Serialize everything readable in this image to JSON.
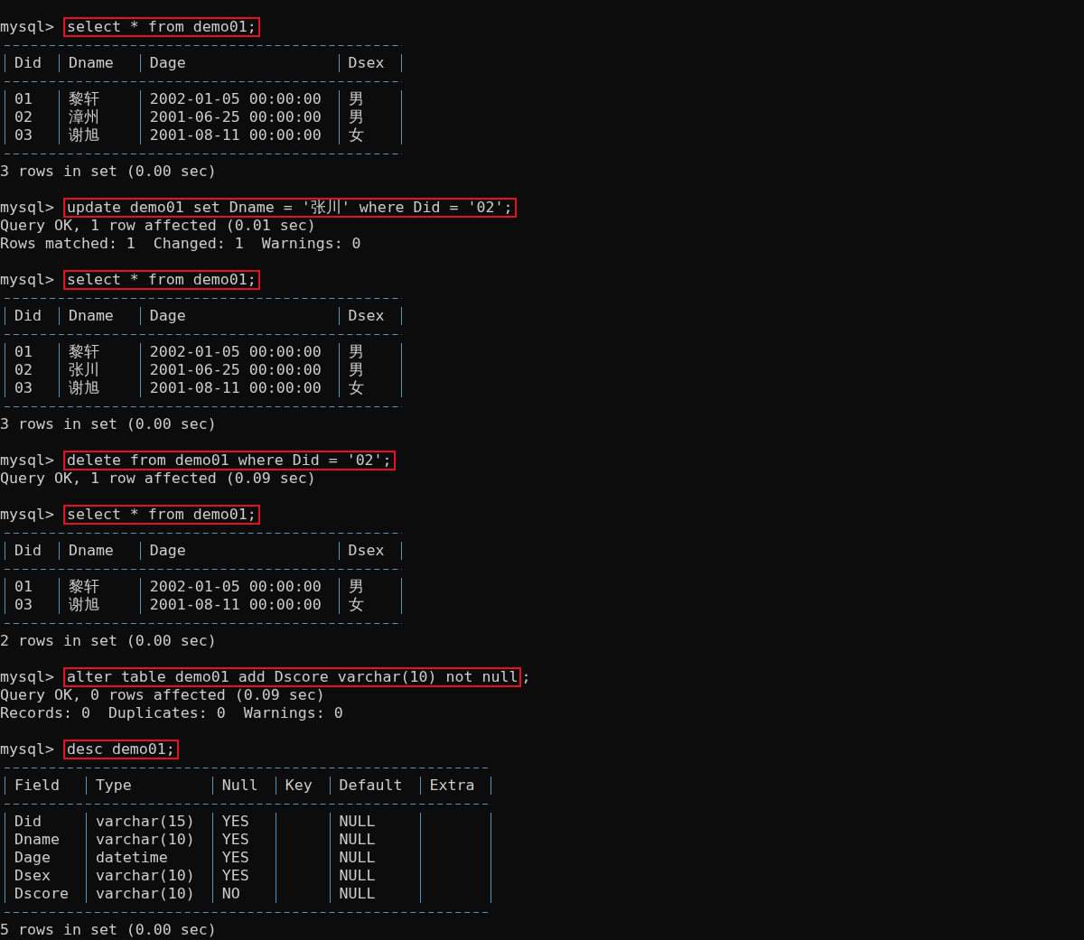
{
  "blocks": [
    {
      "kind": "command",
      "prompt": "mysql>",
      "command": "select * from demo01;",
      "highlighted": true
    },
    {
      "kind": "table",
      "columns": [
        "Did",
        "Dname",
        "Dage",
        "Dsex"
      ],
      "rows": [
        [
          "01",
          "黎轩",
          "2002-01-05 00:00:00",
          "男"
        ],
        [
          "02",
          "漳州",
          "2001-06-25 00:00:00",
          "男"
        ],
        [
          "03",
          "谢旭",
          "2001-08-11 00:00:00",
          "女"
        ]
      ]
    },
    {
      "kind": "line",
      "text": "3 rows in set (0.00 sec)"
    },
    {
      "kind": "blank"
    },
    {
      "kind": "command",
      "prompt": "mysql>",
      "command": "update demo01 set Dname = '张川' where Did = '02';",
      "highlighted": true
    },
    {
      "kind": "line",
      "text": "Query OK, 1 row affected (0.01 sec)"
    },
    {
      "kind": "line",
      "text": "Rows matched: 1  Changed: 1  Warnings: 0"
    },
    {
      "kind": "blank"
    },
    {
      "kind": "command",
      "prompt": "mysql>",
      "command": "select * from demo01;",
      "highlighted": true
    },
    {
      "kind": "table",
      "columns": [
        "Did",
        "Dname",
        "Dage",
        "Dsex"
      ],
      "rows": [
        [
          "01",
          "黎轩",
          "2002-01-05 00:00:00",
          "男"
        ],
        [
          "02",
          "张川",
          "2001-06-25 00:00:00",
          "男"
        ],
        [
          "03",
          "谢旭",
          "2001-08-11 00:00:00",
          "女"
        ]
      ]
    },
    {
      "kind": "line",
      "text": "3 rows in set (0.00 sec)"
    },
    {
      "kind": "blank"
    },
    {
      "kind": "command",
      "prompt": "mysql>",
      "command": "delete from demo01 where Did = '02';",
      "highlighted": true
    },
    {
      "kind": "line",
      "text": "Query OK, 1 row affected (0.09 sec)"
    },
    {
      "kind": "blank"
    },
    {
      "kind": "command",
      "prompt": "mysql>",
      "command": "select * from demo01;",
      "highlighted": true
    },
    {
      "kind": "table",
      "columns": [
        "Did",
        "Dname",
        "Dage",
        "Dsex"
      ],
      "rows": [
        [
          "01",
          "黎轩",
          "2002-01-05 00:00:00",
          "男"
        ],
        [
          "03",
          "谢旭",
          "2001-08-11 00:00:00",
          "女"
        ]
      ]
    },
    {
      "kind": "line",
      "text": "2 rows in set (0.00 sec)"
    },
    {
      "kind": "blank"
    },
    {
      "kind": "command",
      "prompt": "mysql>",
      "command": "alter table demo01 add Dscore varchar(10) not null",
      "tail": ";",
      "highlighted": true
    },
    {
      "kind": "line",
      "text": "Query OK, 0 rows affected (0.09 sec)"
    },
    {
      "kind": "line",
      "text": "Records: 0  Duplicates: 0  Warnings: 0"
    },
    {
      "kind": "blank"
    },
    {
      "kind": "command",
      "prompt": "mysql>",
      "command": "desc demo01;",
      "highlighted": true
    },
    {
      "kind": "table",
      "columns": [
        "Field",
        "Type",
        "Null",
        "Key",
        "Default",
        "Extra"
      ],
      "rows": [
        [
          "Did",
          "varchar(15)",
          "YES",
          "",
          "NULL",
          ""
        ],
        [
          "Dname",
          "varchar(10)",
          "YES",
          "",
          "NULL",
          ""
        ],
        [
          "Dage",
          "datetime",
          "YES",
          "",
          "NULL",
          ""
        ],
        [
          "Dsex",
          "varchar(10)",
          "YES",
          "",
          "NULL",
          ""
        ],
        [
          "Dscore",
          "varchar(10)",
          "NO",
          "",
          "NULL",
          ""
        ]
      ]
    },
    {
      "kind": "line",
      "text": "5 rows in set (0.00 sec)"
    }
  ]
}
